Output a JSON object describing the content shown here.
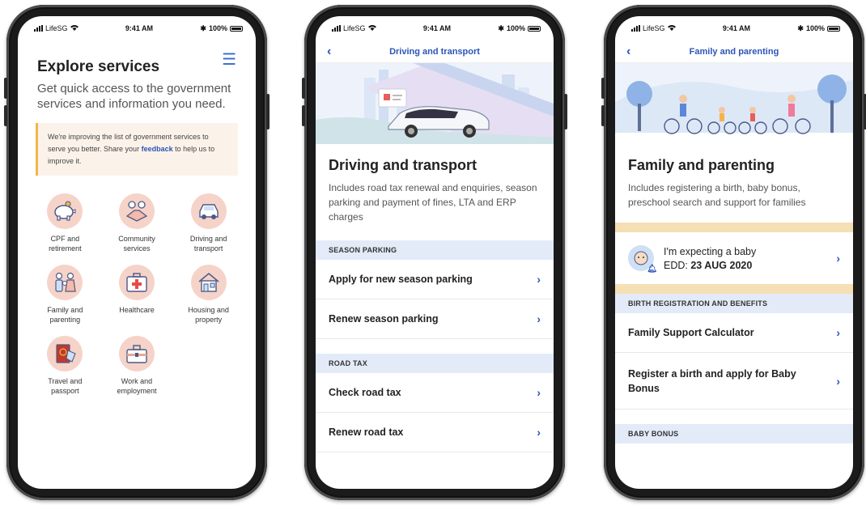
{
  "status": {
    "carrier": "LifeSG",
    "time": "9:41 AM",
    "battery": "100%"
  },
  "screen1": {
    "title": "Explore services",
    "subtitle": "Get quick access to the government services and information you need.",
    "notice": {
      "before": "We're improving the list of government services to serve you better. Share your ",
      "link": "feedback",
      "after": " to help us to improve it."
    },
    "services": [
      {
        "label": "CPF and retirement",
        "icon": "piggy-bank-icon"
      },
      {
        "label": "Community services",
        "icon": "handshake-icon"
      },
      {
        "label": "Driving and transport",
        "icon": "car-icon"
      },
      {
        "label": "Family and parenting",
        "icon": "family-icon"
      },
      {
        "label": "Healthcare",
        "icon": "first-aid-kit-icon"
      },
      {
        "label": "Housing and property",
        "icon": "house-icon"
      },
      {
        "label": "Travel and passport",
        "icon": "passport-icon"
      },
      {
        "label": "Work and employment",
        "icon": "briefcase-icon"
      }
    ]
  },
  "screen2": {
    "nav_title": "Driving and transport",
    "title": "Driving and transport",
    "description": "Includes road tax renewal and enquiries, season parking and payment of fines, LTA and ERP charges",
    "sections": [
      {
        "header": "SEASON PARKING",
        "items": [
          "Apply for new season parking",
          "Renew season parking"
        ]
      },
      {
        "header": "ROAD TAX",
        "items": [
          "Check road tax",
          "Renew road tax"
        ]
      }
    ]
  },
  "screen3": {
    "nav_title": "Family and parenting",
    "title": "Family and parenting",
    "description": "Includes registering a birth, baby bonus, preschool search and support for families",
    "expecting": {
      "title": "I'm expecting a baby",
      "edd_label": "EDD: ",
      "edd_value": "23 AUG 2020"
    },
    "sections": [
      {
        "header": "BIRTH REGISTRATION AND BENEFITS",
        "items": [
          "Family Support Calculator",
          "Register a birth and apply for Baby Bonus"
        ]
      },
      {
        "header": "BABY BONUS",
        "items": []
      }
    ]
  },
  "colors": {
    "accent": "#2b55b8",
    "section_bg": "#e3ebf9",
    "icon_bg": "#f6d3c8",
    "notice_border": "#f3b54a"
  }
}
